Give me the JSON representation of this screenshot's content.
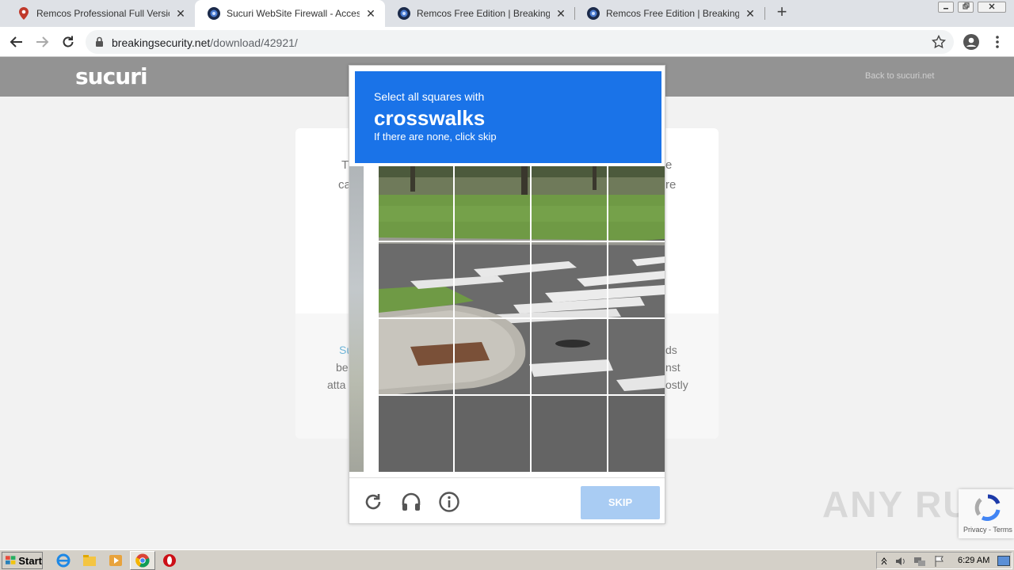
{
  "browser": {
    "tabs": [
      {
        "title": "Remcos Professional Full Version Dow",
        "active": false,
        "icon": "map-pin-icon"
      },
      {
        "title": "Sucuri WebSite Firewall - Access Den",
        "active": true,
        "icon": "breakingsecurity-icon"
      },
      {
        "title": "Remcos Free Edition | BreakingSecur",
        "active": false,
        "icon": "breakingsecurity-icon"
      },
      {
        "title": "Remcos Free Edition | BreakingSecur",
        "active": false,
        "icon": "breakingsecurity-icon"
      }
    ],
    "close_glyph": "✕",
    "new_tab_glyph": "+",
    "url_host": "breakingsecurity.net",
    "url_path": "/download/42921/"
  },
  "page": {
    "logo": "sucuri",
    "back_link": "Back to sucuri.net",
    "peek": {
      "l1": "T",
      "l2": "ca",
      "r1": "e",
      "r2": "re",
      "bl1": "Su",
      "bl2": "be",
      "bl3": "atta",
      "br1": "ds",
      "br2": "nst",
      "br3": "ostly"
    }
  },
  "captcha": {
    "prompt": "Select all squares with",
    "keyword": "crosswalks",
    "hint": "If there are none, click skip",
    "skip_label": "SKIP",
    "accent_color": "#1a73e8"
  },
  "watermark": "ANY RUN",
  "recaptcha_badge": "Privacy - Terms",
  "taskbar": {
    "start_label": "Start",
    "clock": "6:29 AM"
  }
}
